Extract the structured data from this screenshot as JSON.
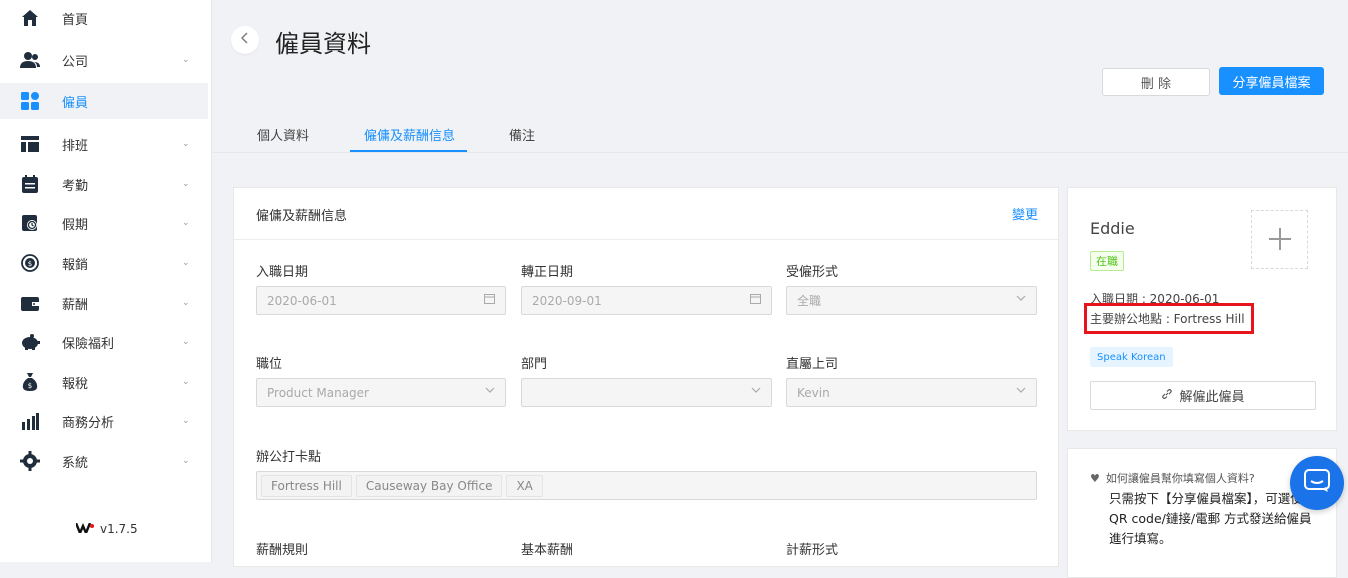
{
  "sidebar": {
    "items": [
      {
        "label": "首頁",
        "icon": "home-icon",
        "has_caret": false
      },
      {
        "label": "公司",
        "icon": "users-icon",
        "has_caret": true
      },
      {
        "label": "僱員",
        "icon": "dashboard-icon",
        "has_caret": false,
        "active": true
      },
      {
        "label": "排班",
        "icon": "calendar-grid-icon",
        "has_caret": true
      },
      {
        "label": "考勤",
        "icon": "attendance-icon",
        "has_caret": true
      },
      {
        "label": "假期",
        "icon": "leave-icon",
        "has_caret": true
      },
      {
        "label": "報銷",
        "icon": "reimburse-icon",
        "has_caret": true
      },
      {
        "label": "薪酬",
        "icon": "wallet-icon",
        "has_caret": true
      },
      {
        "label": "保險福利",
        "icon": "piggy-bank-icon",
        "has_caret": true
      },
      {
        "label": "報稅",
        "icon": "money-bag-icon",
        "has_caret": true
      },
      {
        "label": "商務分析",
        "icon": "bar-chart-icon",
        "has_caret": true
      },
      {
        "label": "系統",
        "icon": "gear-icon",
        "has_caret": true
      }
    ],
    "version": "v1.7.5"
  },
  "header": {
    "title": "僱員資料",
    "delete_label": "刪 除",
    "share_label": "分享僱員檔案"
  },
  "tabs": [
    "個人資料",
    "僱傭及薪酬信息",
    "備注"
  ],
  "main_card": {
    "title": "僱傭及薪酬信息",
    "change_label": "變更",
    "fields": {
      "join_date": {
        "label": "入職日期",
        "value": "2020-06-01"
      },
      "confirm_date": {
        "label": "轉正日期",
        "value": "2020-09-01"
      },
      "employment_type": {
        "label": "受僱形式",
        "value": "全職"
      },
      "position": {
        "label": "職位",
        "value": "Product Manager"
      },
      "department": {
        "label": "部門",
        "value": ""
      },
      "supervisor": {
        "label": "直屬上司",
        "value": "Kevin"
      },
      "clock_location": {
        "label": "辦公打卡點",
        "tags": [
          "Fortress Hill",
          "Causeway Bay Office",
          "XA"
        ]
      },
      "salary_rule": {
        "label": "薪酬規則"
      },
      "base_salary": {
        "label": "基本薪酬"
      },
      "pay_type": {
        "label": "計薪形式"
      }
    }
  },
  "profile_card": {
    "name": "Eddie",
    "status": "在職",
    "join_line": "入職日期 : 2020-06-01",
    "office_line": "主要辦公地點 : Fortress Hill",
    "skill_tag": "Speak Korean",
    "dismiss_label": "解僱此僱員"
  },
  "help_card": {
    "question": "如何讓僱員幫你填寫個人資料?",
    "answer": "只需按下【分享僱員檔案】，可選使用 QR code/鏈接/電郵 方式發送給僱員進行填寫。"
  },
  "colors": {
    "accent": "#1890ff",
    "highlight": "#e8141c",
    "active_green": "#52c41a"
  }
}
